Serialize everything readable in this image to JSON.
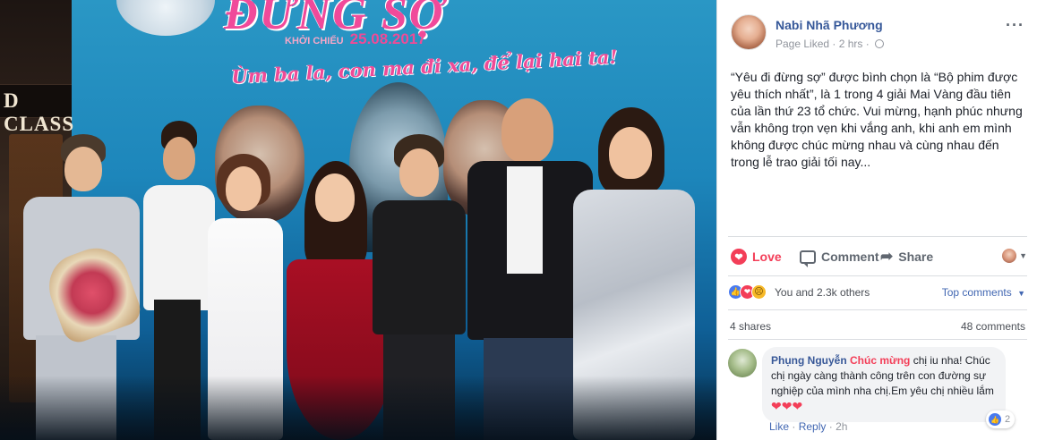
{
  "photo": {
    "store_sign": "D CLASS",
    "release_label": "KHỞI CHIẾU",
    "release_date": "25.08.2017",
    "movie_title": "ĐỪNG SỢ",
    "tagline": "Ùm ba la, con ma đi xa, để lại hai ta!"
  },
  "post": {
    "author": "Nabi Nhã Phương",
    "meta": "Page Liked · 2 hrs ·",
    "more_label": "···",
    "text": "“Yêu đi đừng sợ” được bình chọn là “Bộ phim được yêu thích nhất”, là 1 trong 4 giải Mai Vàng đầu tiên của lần thứ 23 tổ chức. Vui mừng, hạnh phúc nhưng vẫn không trọn vẹn khi vắng anh, khi anh em mình không được chúc mừng nhau và cùng nhau đến trong lễ trao giải tối nay...",
    "actions": {
      "love": "Love",
      "comment": "Comment",
      "share": "Share"
    },
    "reactions_text": "You and 2.3k others",
    "top_comments": "Top comments",
    "shares": "4 shares",
    "comments_count": "48 comments"
  },
  "comment": {
    "name": "Phụng Nguyễn",
    "tag": "Chúc mừng",
    "text": " chị iu nha! Chúc chị ngày càng thành công trên con đường sự nghiệp của mình nha chị.Em yêu chị nhiều lắm",
    "hearts": "❤❤❤",
    "like": "Like",
    "reply": "Reply",
    "time": "2h",
    "like_count": "2"
  },
  "colors": {
    "link_blue": "#365899",
    "love_red": "#f33e58",
    "like_blue": "#4a7bef"
  }
}
